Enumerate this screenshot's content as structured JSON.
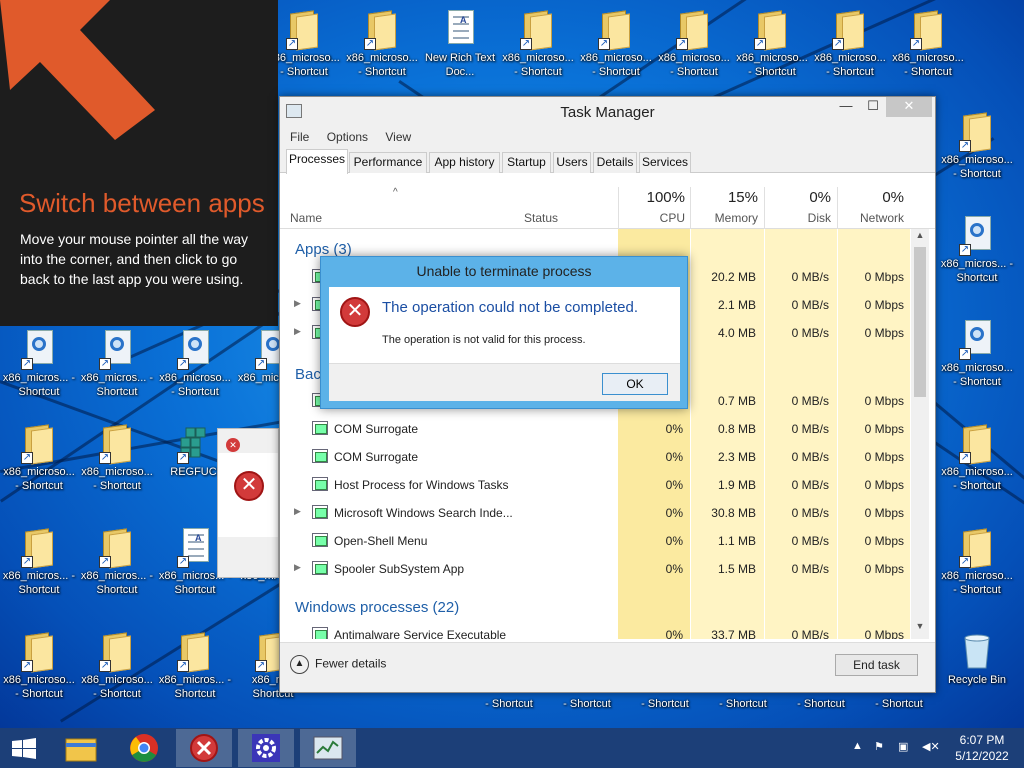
{
  "charm": {
    "title": "Switch between apps",
    "body": "Move your mouse pointer all the way into the corner, and then click to go back to the last app you were using."
  },
  "desktop": {
    "top_row": [
      {
        "label": "x86_microso... - Shortcut",
        "type": "folder"
      },
      {
        "label": "x86_microso... - Shortcut",
        "type": "folder"
      },
      {
        "label": "New Rich Text Doc...",
        "type": "doc"
      },
      {
        "label": "x86_microso... - Shortcut",
        "type": "folder"
      },
      {
        "label": "x86_microso... - Shortcut",
        "type": "folder"
      },
      {
        "label": "x86_microso... - Shortcut",
        "type": "folder"
      },
      {
        "label": "x86_microso... - Shortcut",
        "type": "folder"
      },
      {
        "label": "x86_microso... - Shortcut",
        "type": "folder"
      },
      {
        "label": "x86_microso... - Shortcut",
        "type": "folder"
      }
    ],
    "left_rows": [
      [
        {
          "label": "x86_micros... - Shortcut",
          "type": "mag"
        },
        {
          "label": "x86_micros... - Shortcut",
          "type": "mag"
        },
        {
          "label": "x86_microso... - Shortcut",
          "type": "mag"
        },
        {
          "label": "x86_mic - Sho",
          "type": "mag"
        }
      ],
      [
        {
          "label": "x86_microso... - Shortcut",
          "type": "folder"
        },
        {
          "label": "x86_microso... - Shortcut",
          "type": "folder"
        },
        {
          "label": "REGFUCI",
          "type": "reg"
        }
      ],
      [
        {
          "label": "x86_micros... - Shortcut",
          "type": "folder"
        },
        {
          "label": "x86_micros... - Shortcut",
          "type": "folder"
        },
        {
          "label": "x86_micros... - Shortcut",
          "type": "doc"
        },
        {
          "label": "x86_mi - Sho",
          "type": "folder"
        }
      ],
      [
        {
          "label": "x86_microso... - Shortcut",
          "type": "folder"
        },
        {
          "label": "x86_microso... - Shortcut",
          "type": "folder"
        },
        {
          "label": "x86_micros... - Shortcut",
          "type": "folder"
        },
        {
          "label": "x86_mi - Shortcut",
          "type": "folder"
        }
      ]
    ],
    "right_col": [
      {
        "label": "x86_microso... - Shortcut",
        "type": "folder"
      },
      {
        "label": "x86_micros... - Shortcut",
        "type": "mag"
      },
      {
        "label": "x86_microso... - Shortcut",
        "type": "mag"
      },
      {
        "label": "x86_microso... - Shortcut",
        "type": "folder"
      },
      {
        "label": "x86_microso... - Shortcut",
        "type": "folder"
      },
      {
        "label": "Recycle Bin",
        "type": "bin"
      }
    ],
    "bottom_partial": [
      "- Shortcut",
      "- Shortcut",
      "- Shortcut",
      "- Shortcut",
      "- Shortcut",
      "- Shortcut"
    ]
  },
  "taskmanager": {
    "title": "Task Manager",
    "menu": [
      "File",
      "Options",
      "View"
    ],
    "tabs": [
      "Processes",
      "Performance",
      "App history",
      "Startup",
      "Users",
      "Details",
      "Services"
    ],
    "active_tab": "Processes",
    "columns": {
      "name": "Name",
      "status": "Status",
      "cpu_pct": "100%",
      "cpu": "CPU",
      "mem_pct": "15%",
      "mem": "Memory",
      "disk_pct": "0%",
      "disk": "Disk",
      "net_pct": "0%",
      "net": "Network"
    },
    "groups": {
      "apps": "Apps (3)",
      "background": "Back",
      "windows": "Windows processes (22)"
    },
    "app_rows": [
      {
        "mem": "20.2 MB",
        "disk": "0 MB/s",
        "net": "0 Mbps"
      },
      {
        "mem": "2.1 MB",
        "disk": "0 MB/s",
        "net": "0 Mbps"
      },
      {
        "mem": "4.0 MB",
        "disk": "0 MB/s",
        "net": "0 Mbps"
      }
    ],
    "bg_rows": [
      {
        "name": "",
        "cpu": "",
        "mem": "0.7 MB",
        "disk": "0 MB/s",
        "net": "0 Mbps",
        "expand": false
      },
      {
        "name": "COM Surrogate",
        "cpu": "0%",
        "mem": "0.8 MB",
        "disk": "0 MB/s",
        "net": "0 Mbps",
        "expand": false
      },
      {
        "name": "COM Surrogate",
        "cpu": "0%",
        "mem": "2.3 MB",
        "disk": "0 MB/s",
        "net": "0 Mbps",
        "expand": false
      },
      {
        "name": "Host Process for Windows Tasks",
        "cpu": "0%",
        "mem": "1.9 MB",
        "disk": "0 MB/s",
        "net": "0 Mbps",
        "expand": false
      },
      {
        "name": "Microsoft Windows Search Inde...",
        "cpu": "0%",
        "mem": "30.8 MB",
        "disk": "0 MB/s",
        "net": "0 Mbps",
        "expand": true
      },
      {
        "name": "Open-Shell Menu",
        "cpu": "0%",
        "mem": "1.1 MB",
        "disk": "0 MB/s",
        "net": "0 Mbps",
        "expand": false
      },
      {
        "name": "Spooler SubSystem App",
        "cpu": "0%",
        "mem": "1.5 MB",
        "disk": "0 MB/s",
        "net": "0 Mbps",
        "expand": true
      }
    ],
    "win_rows": [
      {
        "name": "Antimalware Service Executable",
        "cpu": "0%",
        "mem": "33.7 MB",
        "disk": "0 MB/s",
        "net": "0 Mbps"
      }
    ],
    "fewer_details": "Fewer details",
    "end_task": "End task"
  },
  "dialog": {
    "title": "Unable to terminate process",
    "main": "The operation could not be completed.",
    "sub": "The operation is not valid for this process.",
    "ok": "OK"
  },
  "taskbar": {
    "time": "6:07 PM",
    "date": "5/12/2022"
  }
}
